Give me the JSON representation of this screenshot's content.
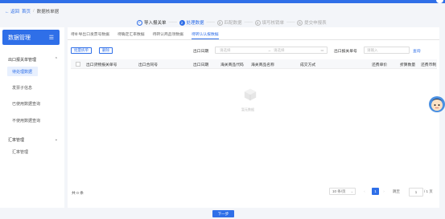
{
  "breadcrumb": {
    "back": "返回",
    "sep": "/",
    "home": "首页",
    "current": "数据核单据"
  },
  "steps": [
    {
      "num": "✓",
      "label": "导入报关单",
      "state": "done"
    },
    {
      "num": "2",
      "label": "处理数据",
      "state": "active"
    },
    {
      "num": "3",
      "label": "匹配数据",
      "state": "todo"
    },
    {
      "num": "4",
      "label": "填写核销单",
      "state": "todo"
    },
    {
      "num": "5",
      "label": "提交申报表",
      "state": "todo"
    }
  ],
  "step_dash": "——",
  "sidebar": {
    "title": "数据管理",
    "menu_icon": "menu-icon",
    "group1": "出口报关单管理",
    "items1": [
      "待处理数据",
      "发票子信息",
      "已使用数据查询",
      "不使用数据查询"
    ],
    "group2": "汇率管理",
    "items2": [
      "汇率管理"
    ]
  },
  "tabs": [
    "待补导出口发票号数据",
    "待确定汇率数据",
    "待转认商品领数据",
    "待转认认报数据"
  ],
  "toolbar": {
    "batch_split": "批量拆单",
    "delete": "删除"
  },
  "filters": {
    "date_label": "出口日期",
    "date_start": "请选择",
    "date_arrow": "→",
    "date_end": "请选择",
    "calendar_icon": "calendar-icon",
    "decl_label": "出口报关单号",
    "decl_placeholder": "请输入",
    "query": "查询"
  },
  "columns": [
    "出口货物报关单号",
    "出口合同号",
    "出口日期",
    "海关商品代码",
    "海关商品名称",
    "成交方式",
    "还费单价",
    "折算数量",
    "还费币制"
  ],
  "empty_text": "暂无数据",
  "pagination": {
    "total": "共 0 条",
    "page_size": "10 条/页",
    "prev": "‹",
    "page": "1",
    "next": "›",
    "goto": "跳至",
    "goto_value": "1",
    "total_pages": "/ 1 页"
  },
  "next_button": "下一步",
  "colors": {
    "primary": "#2f6fe8",
    "bg": "#f3f5f9"
  }
}
